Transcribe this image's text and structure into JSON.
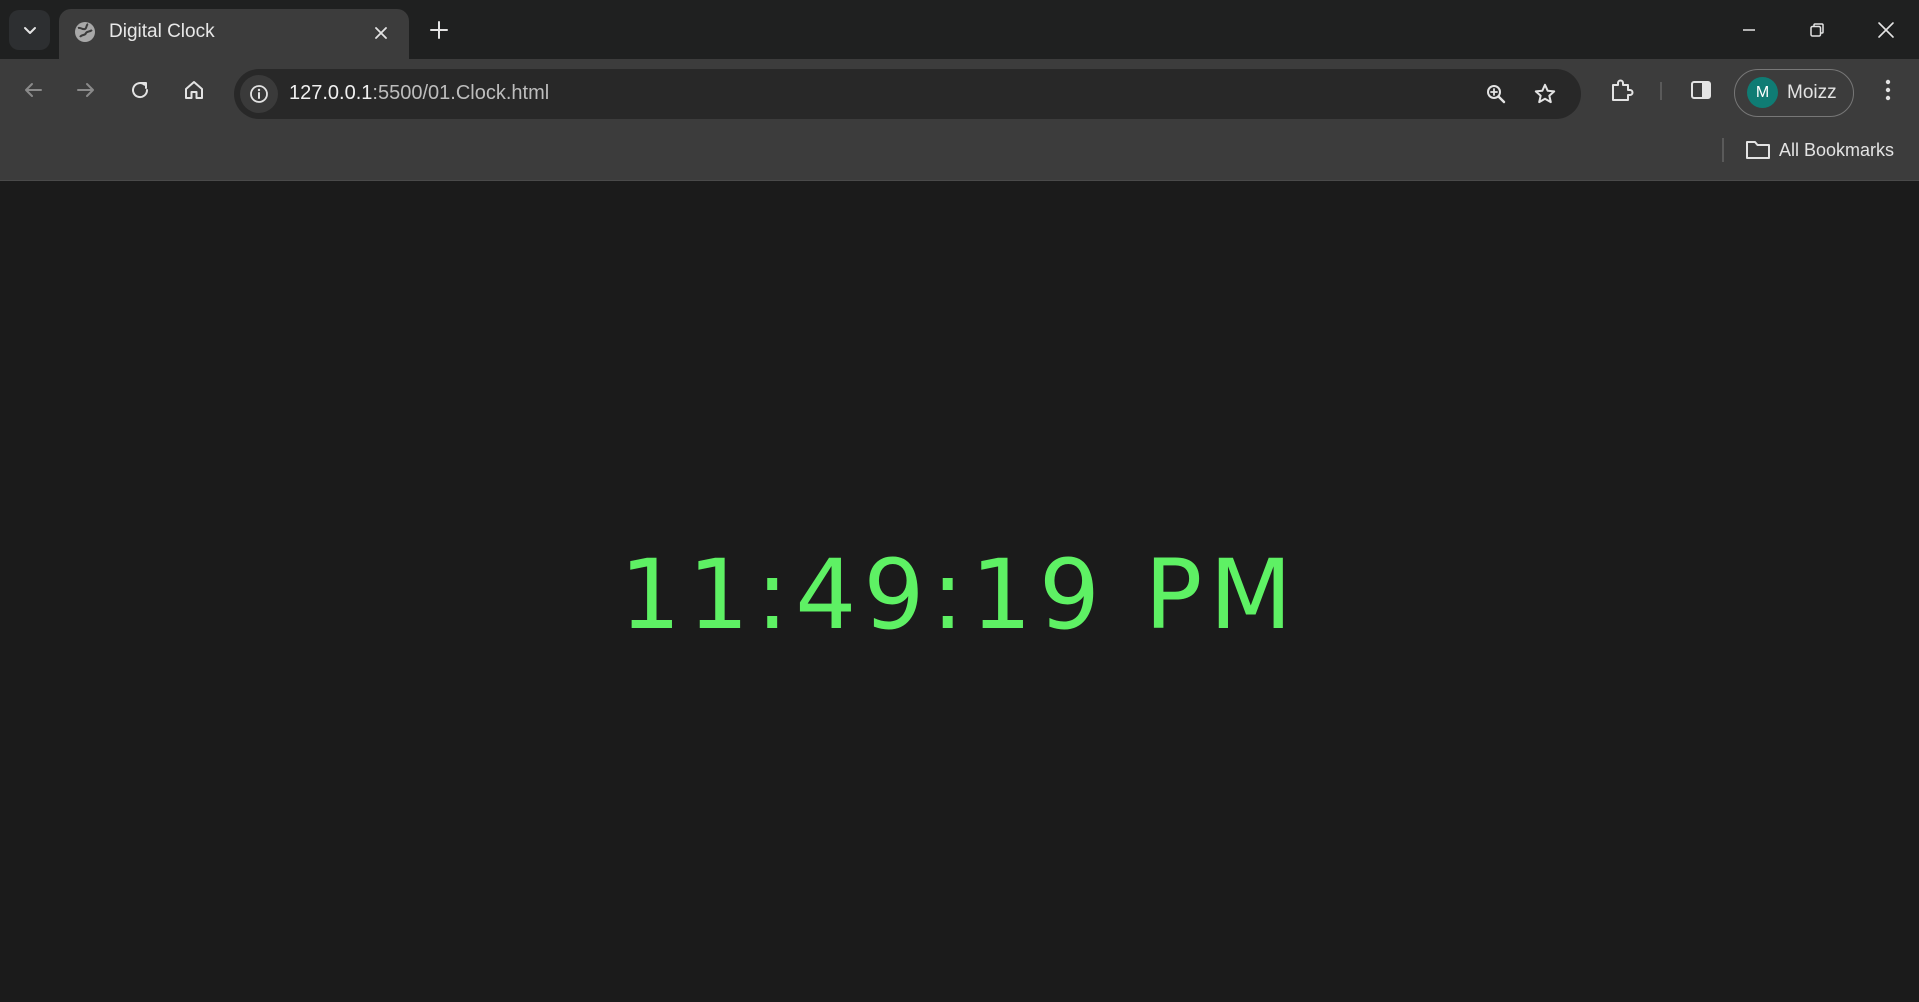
{
  "tabs": [
    {
      "title": "Digital Clock",
      "active": true
    }
  ],
  "toolbar": {
    "url_host": "127.0.0.1",
    "url_path": ":5500/01.Clock.html"
  },
  "profile": {
    "initial": "M",
    "name": "Moizz",
    "avatar_color": "#0f7c74"
  },
  "bookmarks_bar": {
    "all_bookmarks_label": "All Bookmarks"
  },
  "page": {
    "clock_text": "11:49:19 PM",
    "clock_color": "#5ef164",
    "background_color": "#1b1b1b"
  },
  "icons": {
    "tab_search": "chevron-down-icon",
    "favicon": "globe-icon",
    "tab_close": "close-icon",
    "new_tab": "plus-icon",
    "back": "arrow-left-icon",
    "forward": "arrow-right-icon",
    "reload": "reload-icon",
    "home": "home-icon",
    "site_info": "info-icon",
    "zoom": "zoom-in-icon",
    "bookmark": "star-icon",
    "extensions": "puzzle-icon",
    "side_panel": "side-panel-icon",
    "menu": "kebab-menu-icon",
    "folder": "folder-icon"
  }
}
